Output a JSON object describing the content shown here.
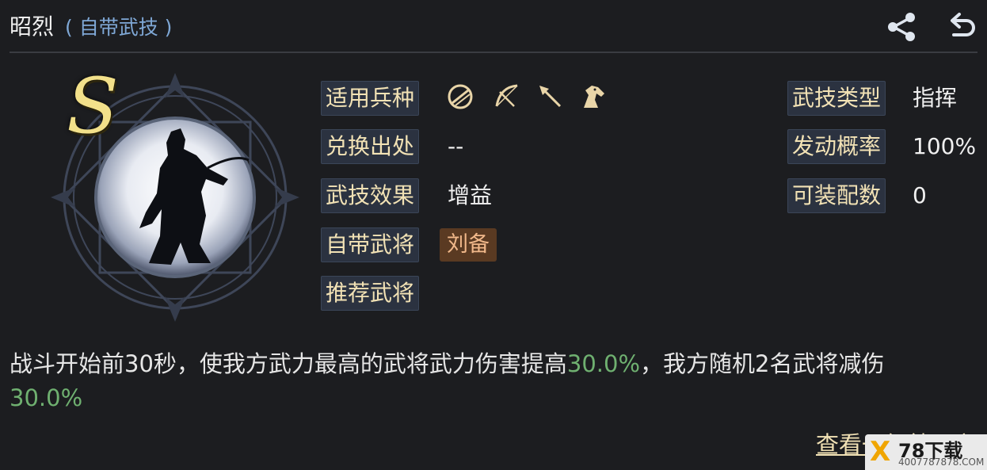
{
  "header": {
    "title": "昭烈",
    "subtitle": "( 自带武技 )"
  },
  "skill": {
    "grade": "S"
  },
  "rows": {
    "troop_label": "适用兵种",
    "troop_icons": [
      "shield-icon",
      "bow-icon",
      "spear-icon",
      "horse-icon"
    ],
    "source_label": "兑换出处",
    "source_value": "--",
    "effect_label": "武技效果",
    "effect_value": "增益",
    "owner_label": "自带武将",
    "owner_value": "刘备",
    "recommend_label": "推荐武将",
    "type_label": "武技类型",
    "type_value": "指挥",
    "chance_label": "发动概率",
    "chance_value": "100%",
    "slots_label": "可装配数",
    "slots_value": "0"
  },
  "description": {
    "part1": "战斗开始前30秒，使我方武力最高的武将武力伤害提高",
    "hl1": "30.0%",
    "part2": "，我方随机2名武将减伤",
    "hl2": "30.0%"
  },
  "footer": {
    "more_label": "查看一级效果",
    "more_arrow": "〉"
  },
  "watermark": {
    "brand": "X",
    "text": "78下载",
    "site": "4007787878.COM"
  },
  "colors": {
    "background": "#1c1d20",
    "label_bg": "#2b3240",
    "label_text": "#f2e2b5",
    "highlight": "#6fb070",
    "owner_tag": "#5a3a22",
    "subtitle": "#7fa8d6"
  }
}
